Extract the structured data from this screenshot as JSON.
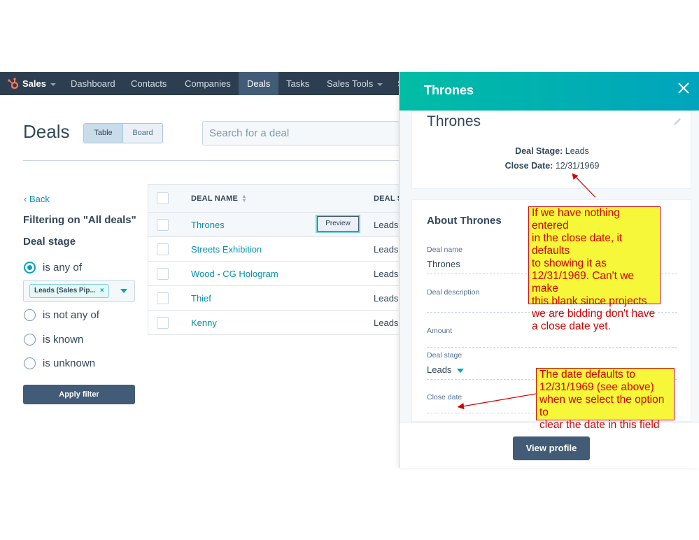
{
  "navbar": {
    "brand": "Sales",
    "items": [
      "Dashboard",
      "Contacts",
      "Companies",
      "Deals",
      "Tasks",
      "Sales Tools"
    ],
    "active": "Deals",
    "truncated_item": "S"
  },
  "page": {
    "title": "Deals",
    "view_toggle": [
      "Table",
      "Board"
    ],
    "search_placeholder": "Search for a deal"
  },
  "filters": {
    "back_label": "Back",
    "heading": "Filtering on \"All deals\"",
    "group_label": "Deal stage",
    "options": [
      "is any of",
      "is not any of",
      "is known",
      "is unknown"
    ],
    "selected_option": "is any of",
    "selected_tag": "Leads (Sales Pip...",
    "apply_label": "Apply filter"
  },
  "table": {
    "columns": [
      "DEAL NAME",
      "DEAL S"
    ],
    "rows": [
      {
        "name": "Thrones",
        "stage": "Leads"
      },
      {
        "name": "Streets Exhibition",
        "stage": "Leads"
      },
      {
        "name": "Wood - CG Hologram",
        "stage": "Leads"
      },
      {
        "name": "Thief",
        "stage": "Leads"
      },
      {
        "name": "Kenny",
        "stage": "Leads"
      }
    ],
    "preview_label": "Preview"
  },
  "panel": {
    "header_title": "Thrones",
    "record_name": "Thrones",
    "stage_label": "Deal Stage:",
    "stage_value": "Leads",
    "close_label": "Close Date:",
    "close_value": "12/31/1969",
    "about_title": "About Thrones",
    "properties": {
      "deal_name_label": "Deal name",
      "deal_name_value": "Thrones",
      "deal_description_label": "Deal description",
      "amount_label": "Amount",
      "deal_stage_label": "Deal stage",
      "deal_stage_value": "Leads",
      "close_date_label": "Close date"
    },
    "view_profile_label": "View profile"
  },
  "annotations": {
    "note1": "If we have nothing entered\nin the close date, it defaults\nto showing it as\n12/31/1969. Can't we make\nthis blank since projects\nwe are bidding don't have\na close date yet.",
    "note2": "The date defaults to\n12/31/1969 (see above)\nwhen we select the option to\nclear the date in this field"
  },
  "colors": {
    "navbar": "#2d3e50",
    "panel_header_start": "#00bda5",
    "panel_header_end": "#00a4bd",
    "link": "#0091ae",
    "button": "#425b76",
    "note_bg": "#f7f739",
    "note_text": "#d40000"
  },
  "icons": [
    "hubspot-logo-icon",
    "chevron-left-icon",
    "close-icon",
    "pencil-icon",
    "sort-icon",
    "caret-down-icon"
  ]
}
